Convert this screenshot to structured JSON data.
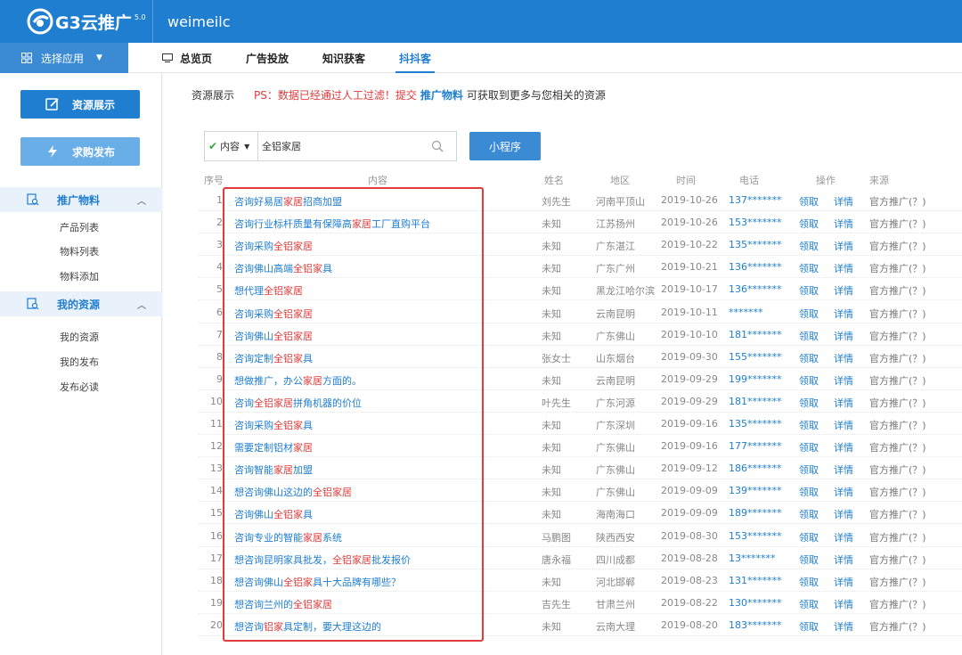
{
  "header": {
    "brand": "G3云推广",
    "version": "5.0",
    "tenant": "weimeilc"
  },
  "appbar": {
    "app_select": "选择应用",
    "tabs": [
      {
        "label": "总览页"
      },
      {
        "label": "广告投放"
      },
      {
        "label": "知识获客"
      },
      {
        "label": "抖抖客",
        "active": true
      }
    ]
  },
  "sidebar": {
    "btn_resource": "资源展示",
    "btn_purchase": "求购发布",
    "section1": {
      "title": "推广物料",
      "items": [
        "产品列表",
        "物料列表",
        "物料添加"
      ]
    },
    "section2": {
      "title": "我的资源",
      "items": [
        "我的资源",
        "我的发布",
        "发布必读"
      ]
    }
  },
  "notice": {
    "label": "资源展示",
    "ps": "PS：数据已经通过人工过滤！提交",
    "link": "推广物料",
    "rest": "可获取到更多与您相关的资源"
  },
  "search": {
    "type": "内容",
    "value": "全铝家居",
    "button": "小程序"
  },
  "table": {
    "headers": {
      "no": "序号",
      "content": "内容",
      "name": "姓名",
      "region": "地区",
      "time": "时间",
      "phone": "电话",
      "action": "操作",
      "source": "来源"
    },
    "action_claim": "领取",
    "action_detail": "详情",
    "rows": [
      {
        "no": "1",
        "pre": "咨询好易居",
        "hl": "家居",
        "post": "招商加盟",
        "name": "刘先生",
        "region": "河南平顶山",
        "time": "2019-10-26",
        "phone": "137*******",
        "source": "官方推广(？)"
      },
      {
        "no": "2",
        "pre": "咨询行业标杆质量有保障高",
        "hl": "家居",
        "post": "工厂直购平台",
        "name": "未知",
        "region": "江苏扬州",
        "time": "2019-10-26",
        "phone": "153*******",
        "source": "官方推广(？)"
      },
      {
        "no": "3",
        "pre": "咨询采购",
        "hl": "全铝家居",
        "post": "",
        "name": "未知",
        "region": "广东湛江",
        "time": "2019-10-22",
        "phone": "135*******",
        "source": "官方推广(？)"
      },
      {
        "no": "4",
        "pre": "咨询佛山高端",
        "hl": "全铝家",
        "post": "具",
        "name": "未知",
        "region": "广东广州",
        "time": "2019-10-21",
        "phone": "136*******",
        "source": "官方推广(？)"
      },
      {
        "no": "5",
        "pre": "想代理",
        "hl": "全铝家居",
        "post": "",
        "name": "未知",
        "region": "黑龙江哈尔滨",
        "time": "2019-10-17",
        "phone": "136*******",
        "source": "官方推广(？)"
      },
      {
        "no": "6",
        "pre": "咨询采购",
        "hl": "全铝家居",
        "post": "",
        "name": "未知",
        "region": "云南昆明",
        "time": "2019-10-11",
        "phone": "*******",
        "source": "官方推广(？)"
      },
      {
        "no": "7",
        "pre": "咨询佛山",
        "hl": "全铝家居",
        "post": "",
        "name": "未知",
        "region": "广东佛山",
        "time": "2019-10-10",
        "phone": "181*******",
        "source": "官方推广(？)"
      },
      {
        "no": "8",
        "pre": "咨询定制",
        "hl": "全铝家",
        "post": "具",
        "name": "张女士",
        "region": "山东烟台",
        "time": "2019-09-30",
        "phone": "155*******",
        "source": "官方推广(？)"
      },
      {
        "no": "9",
        "pre": "想做推广，办公",
        "hl": "家居",
        "post": "方面的。",
        "name": "未知",
        "region": "云南昆明",
        "time": "2019-09-29",
        "phone": "199*******",
        "source": "官方推广(？)"
      },
      {
        "no": "10",
        "pre": "咨询",
        "hl": "全铝家居",
        "post": "拼角机器的价位",
        "name": "叶先生",
        "region": "广东河源",
        "time": "2019-09-29",
        "phone": "181*******",
        "source": "官方推广(？)"
      },
      {
        "no": "11",
        "pre": "咨询采购",
        "hl": "全铝家",
        "post": "具",
        "name": "未知",
        "region": "广东深圳",
        "time": "2019-09-16",
        "phone": "135*******",
        "source": "官方推广(？)"
      },
      {
        "no": "12",
        "pre": "需要定制铝材",
        "hl": "家居",
        "post": "",
        "name": "未知",
        "region": "广东佛山",
        "time": "2019-09-16",
        "phone": "177*******",
        "source": "官方推广(？)"
      },
      {
        "no": "13",
        "pre": "咨询智能",
        "hl": "家居",
        "post": "加盟",
        "name": "未知",
        "region": "广东佛山",
        "time": "2019-09-12",
        "phone": "186*******",
        "source": "官方推广(？)"
      },
      {
        "no": "14",
        "pre": "想咨询佛山这边的",
        "hl": "全铝家居",
        "post": "",
        "name": "未知",
        "region": "广东佛山",
        "time": "2019-09-09",
        "phone": "139*******",
        "source": "官方推广(？)"
      },
      {
        "no": "15",
        "pre": "咨询佛山",
        "hl": "全铝家",
        "post": "具",
        "name": "未知",
        "region": "海南海口",
        "time": "2019-09-09",
        "phone": "189*******",
        "source": "官方推广(？)"
      },
      {
        "no": "16",
        "pre": "咨询专业的智能",
        "hl": "家居",
        "post": "系统",
        "name": "马鹏图",
        "region": "陕西西安",
        "time": "2019-08-30",
        "phone": "153*******",
        "source": "官方推广(？)"
      },
      {
        "no": "17",
        "pre": "想咨询昆明家具批发，",
        "hl": "全铝家居",
        "post": "批发报价",
        "name": "唐永福",
        "region": "四川成都",
        "time": "2019-08-28",
        "phone": "13*******",
        "source": "官方推广(？)"
      },
      {
        "no": "18",
        "pre": "想咨询佛山",
        "hl": "全铝家",
        "post": "具十大品牌有哪些？",
        "name": "未知",
        "region": "河北邯郸",
        "time": "2019-08-23",
        "phone": "131*******",
        "source": "官方推广(？)"
      },
      {
        "no": "19",
        "pre": "想咨询兰州的",
        "hl": "全铝家居",
        "post": "",
        "name": "吉先生",
        "region": "甘肃兰州",
        "time": "2019-08-22",
        "phone": "130*******",
        "source": "官方推广(？)"
      },
      {
        "no": "20",
        "pre": "想咨询",
        "hl": "铝家",
        "post": "具定制，要大理这边的",
        "name": "未知",
        "region": "云南大理",
        "time": "2019-08-20",
        "phone": "183*******",
        "source": "官方推广(？)"
      }
    ]
  },
  "colors": {
    "brand": "#1f7ed0",
    "highlight": "#e23b3b"
  }
}
